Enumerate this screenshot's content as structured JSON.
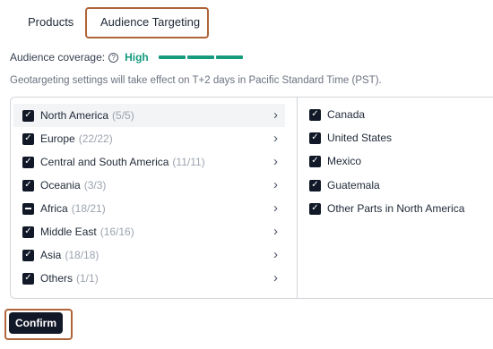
{
  "tabs": [
    {
      "label": "Products"
    },
    {
      "label": "Audience Targeting"
    }
  ],
  "coverage": {
    "label": "Audience coverage:",
    "level": "High",
    "level_color": "#169b7f"
  },
  "note": "Geotargeting settings will take effect on T+2 days in Pacific Standard Time (PST).",
  "regions": [
    {
      "name": "North America",
      "count": "(5/5)",
      "state": "checked"
    },
    {
      "name": "Europe",
      "count": "(22/22)",
      "state": "checked"
    },
    {
      "name": "Central and South America",
      "count": "(11/11)",
      "state": "checked"
    },
    {
      "name": "Oceania",
      "count": "(3/3)",
      "state": "checked"
    },
    {
      "name": "Africa",
      "count": "(18/21)",
      "state": "partial"
    },
    {
      "name": "Middle East",
      "count": "(16/16)",
      "state": "checked"
    },
    {
      "name": "Asia",
      "count": "(18/18)",
      "state": "checked"
    },
    {
      "name": "Others",
      "count": "(1/1)",
      "state": "checked"
    }
  ],
  "countries": [
    {
      "name": "Canada",
      "state": "checked"
    },
    {
      "name": "United States",
      "state": "checked"
    },
    {
      "name": "Mexico",
      "state": "checked"
    },
    {
      "name": "Guatemala",
      "state": "checked"
    },
    {
      "name": "Other Parts in North America",
      "state": "checked"
    }
  ],
  "confirm_label": "Confirm",
  "icons": {
    "help": "help-icon",
    "chevron": "chevron-right-icon",
    "check": "check-icon"
  }
}
